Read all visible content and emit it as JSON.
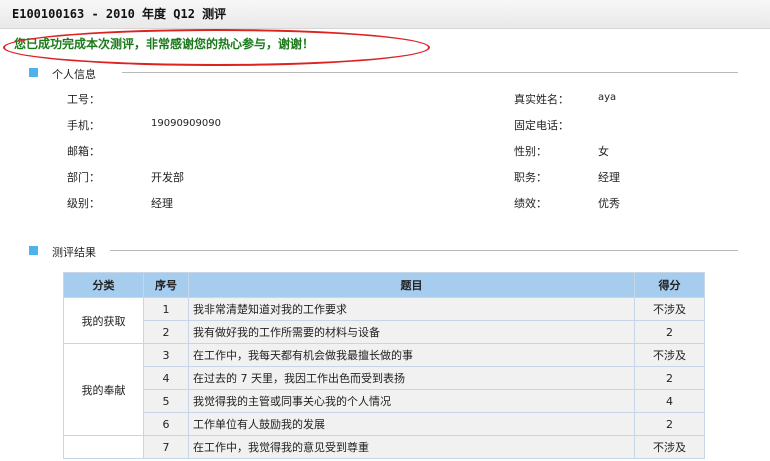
{
  "header": {
    "title": "E100100163 - 2010 年度 Q12 测评"
  },
  "success_message": "您已成功完成本次测评，非常感谢您的热心参与，谢谢！",
  "personal_section": {
    "title": "个人信息",
    "employee_id": {
      "label": "工号：",
      "value": ""
    },
    "real_name": {
      "label": "真实姓名：",
      "value": "aya"
    },
    "mobile": {
      "label": "手机：",
      "value": "19090909090"
    },
    "landline": {
      "label": "固定电话：",
      "value": ""
    },
    "email": {
      "label": "邮箱：",
      "value": ""
    },
    "gender": {
      "label": "性别：",
      "value": "女"
    },
    "department": {
      "label": "部门：",
      "value": "开发部"
    },
    "position": {
      "label": "职务：",
      "value": "经理"
    },
    "level": {
      "label": "级别：",
      "value": "经理"
    },
    "performance": {
      "label": "绩效：",
      "value": "优秀"
    }
  },
  "result_section": {
    "title": "测评结果",
    "headers": {
      "category": "分类",
      "no": "序号",
      "question": "题目",
      "score": "得分"
    },
    "categories": [
      "我的获取",
      "我的奉献"
    ],
    "rows": [
      {
        "no": "1",
        "question": "我非常清楚知道对我的工作要求",
        "score": "不涉及"
      },
      {
        "no": "2",
        "question": "我有做好我的工作所需要的材料与设备",
        "score": "2"
      },
      {
        "no": "3",
        "question": "在工作中，我每天都有机会做我最擅长做的事",
        "score": "不涉及"
      },
      {
        "no": "4",
        "question": "在过去的 7 天里，我因工作出色而受到表扬",
        "score": "2"
      },
      {
        "no": "5",
        "question": "我觉得我的主管或同事关心我的个人情况",
        "score": "4"
      },
      {
        "no": "6",
        "question": "工作单位有人鼓励我的发展",
        "score": "2"
      },
      {
        "no": "7",
        "question": "在工作中，我觉得我的意见受到尊重",
        "score": "不涉及"
      }
    ]
  }
}
